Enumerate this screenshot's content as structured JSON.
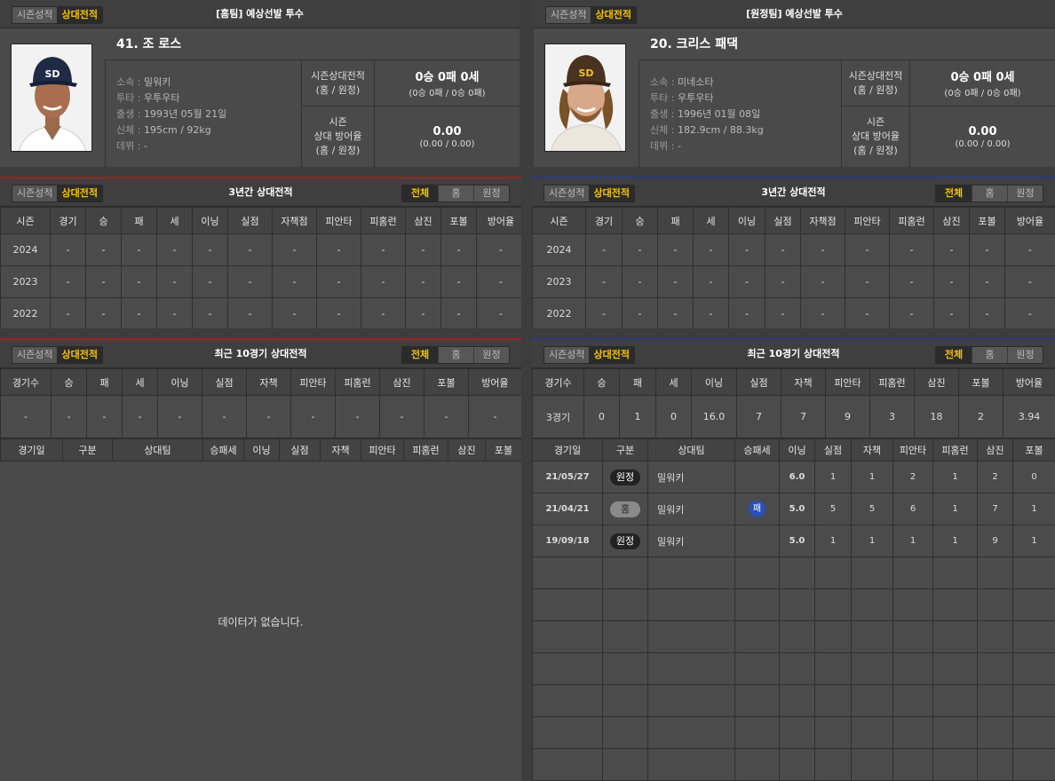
{
  "tabs": {
    "season": "시즌성적",
    "vs": "상대전적"
  },
  "seg": {
    "all": "전체",
    "home": "홈",
    "away": "원정"
  },
  "home": {
    "title": "[홈팀] 예상선발 투수",
    "name": "41. 조 로스",
    "team_label": "소속 : ",
    "team": "밀워키",
    "throws_label": "투타 : ",
    "throws": "우투우타",
    "born_label": "출생 : ",
    "born": "1993년 05월 21일",
    "body_label": "신체 : ",
    "body": "195cm / 92kg",
    "debut_label": "데뷔 : ",
    "debut": "-",
    "rec_label1": "시즌상대전적",
    "rec_label2": "(홈 / 원정)",
    "rec_main": "0승 0패 0세",
    "rec_sub": "(0승 0패 / 0승 0패)",
    "era_label1": "시즌",
    "era_label2": "상대 방어율",
    "era_label3": "(홈 / 원정)",
    "era_main": "0.00",
    "era_sub": "(0.00 / 0.00)",
    "photo_colors": {
      "cap": "#1f2a44",
      "skin": "#a86e4f"
    }
  },
  "away": {
    "title": "[원정팀] 예상선발 투수",
    "name": "20. 크리스 패댁",
    "team_label": "소속 : ",
    "team": "미네소타",
    "throws_label": "투타 : ",
    "throws": "우투우타",
    "born_label": "출생 : ",
    "born": "1996년 01월 08일",
    "body_label": "신체 : ",
    "body": "182.9cm / 88.3kg",
    "debut_label": "데뷔 : ",
    "debut": "-",
    "rec_label1": "시즌상대전적",
    "rec_label2": "(홈 / 원정)",
    "rec_main": "0승 0패 0세",
    "rec_sub": "(0승 0패 / 0승 0패)",
    "era_label1": "시즌",
    "era_label2": "상대 방어율",
    "era_label3": "(홈 / 원정)",
    "era_main": "0.00",
    "era_sub": "(0.00 / 0.00)",
    "photo_colors": {
      "cap": "#4a3220",
      "skin": "#d7a98a"
    }
  },
  "three_year": {
    "title": "3년간 상대전적",
    "headers": [
      "시즌",
      "경기",
      "승",
      "패",
      "세",
      "이닝",
      "실점",
      "자책점",
      "피안타",
      "피홈런",
      "삼진",
      "포볼",
      "방어율"
    ],
    "home_rows": [
      [
        "2024",
        "-",
        "-",
        "-",
        "-",
        "-",
        "-",
        "-",
        "-",
        "-",
        "-",
        "-",
        "-"
      ],
      [
        "2023",
        "-",
        "-",
        "-",
        "-",
        "-",
        "-",
        "-",
        "-",
        "-",
        "-",
        "-",
        "-"
      ],
      [
        "2022",
        "-",
        "-",
        "-",
        "-",
        "-",
        "-",
        "-",
        "-",
        "-",
        "-",
        "-",
        "-"
      ]
    ],
    "away_rows": [
      [
        "2024",
        "-",
        "-",
        "-",
        "-",
        "-",
        "-",
        "-",
        "-",
        "-",
        "-",
        "-",
        "-"
      ],
      [
        "2023",
        "-",
        "-",
        "-",
        "-",
        "-",
        "-",
        "-",
        "-",
        "-",
        "-",
        "-",
        "-"
      ],
      [
        "2022",
        "-",
        "-",
        "-",
        "-",
        "-",
        "-",
        "-",
        "-",
        "-",
        "-",
        "-",
        "-"
      ]
    ]
  },
  "recent": {
    "title": "최근 10경기 상대전적",
    "sum_headers": [
      "경기수",
      "승",
      "패",
      "세",
      "이닝",
      "실점",
      "자책",
      "피안타",
      "피홈런",
      "삼진",
      "포볼",
      "방어율"
    ],
    "home_sum": [
      "-",
      "-",
      "-",
      "-",
      "-",
      "-",
      "-",
      "-",
      "-",
      "-",
      "-",
      "-"
    ],
    "away_sum": [
      "3경기",
      "0",
      "1",
      "0",
      "16.0",
      "7",
      "7",
      "9",
      "3",
      "18",
      "2",
      "3.94"
    ],
    "game_headers": [
      "경기일",
      "구분",
      "상대팀",
      "승패세",
      "이닝",
      "실점",
      "자책",
      "피안타",
      "피홈런",
      "삼진",
      "포볼"
    ],
    "empty_msg": "데이터가 없습니다.",
    "away_games": [
      {
        "date": "21/05/27",
        "type": "원정",
        "kind": "away",
        "opp": "밀워키",
        "res": "",
        "inn": "6.0",
        "r": "1",
        "er": "1",
        "h": "2",
        "hr": "1",
        "so": "2",
        "bb": "0"
      },
      {
        "date": "21/04/21",
        "type": "홈",
        "kind": "home",
        "opp": "밀워키",
        "res": "패",
        "inn": "5.0",
        "r": "5",
        "er": "5",
        "h": "6",
        "hr": "1",
        "so": "7",
        "bb": "1"
      },
      {
        "date": "19/09/18",
        "type": "원정",
        "kind": "away",
        "opp": "밀워키",
        "res": "",
        "inn": "5.0",
        "r": "1",
        "er": "1",
        "h": "1",
        "hr": "1",
        "so": "9",
        "bb": "1"
      }
    ]
  }
}
